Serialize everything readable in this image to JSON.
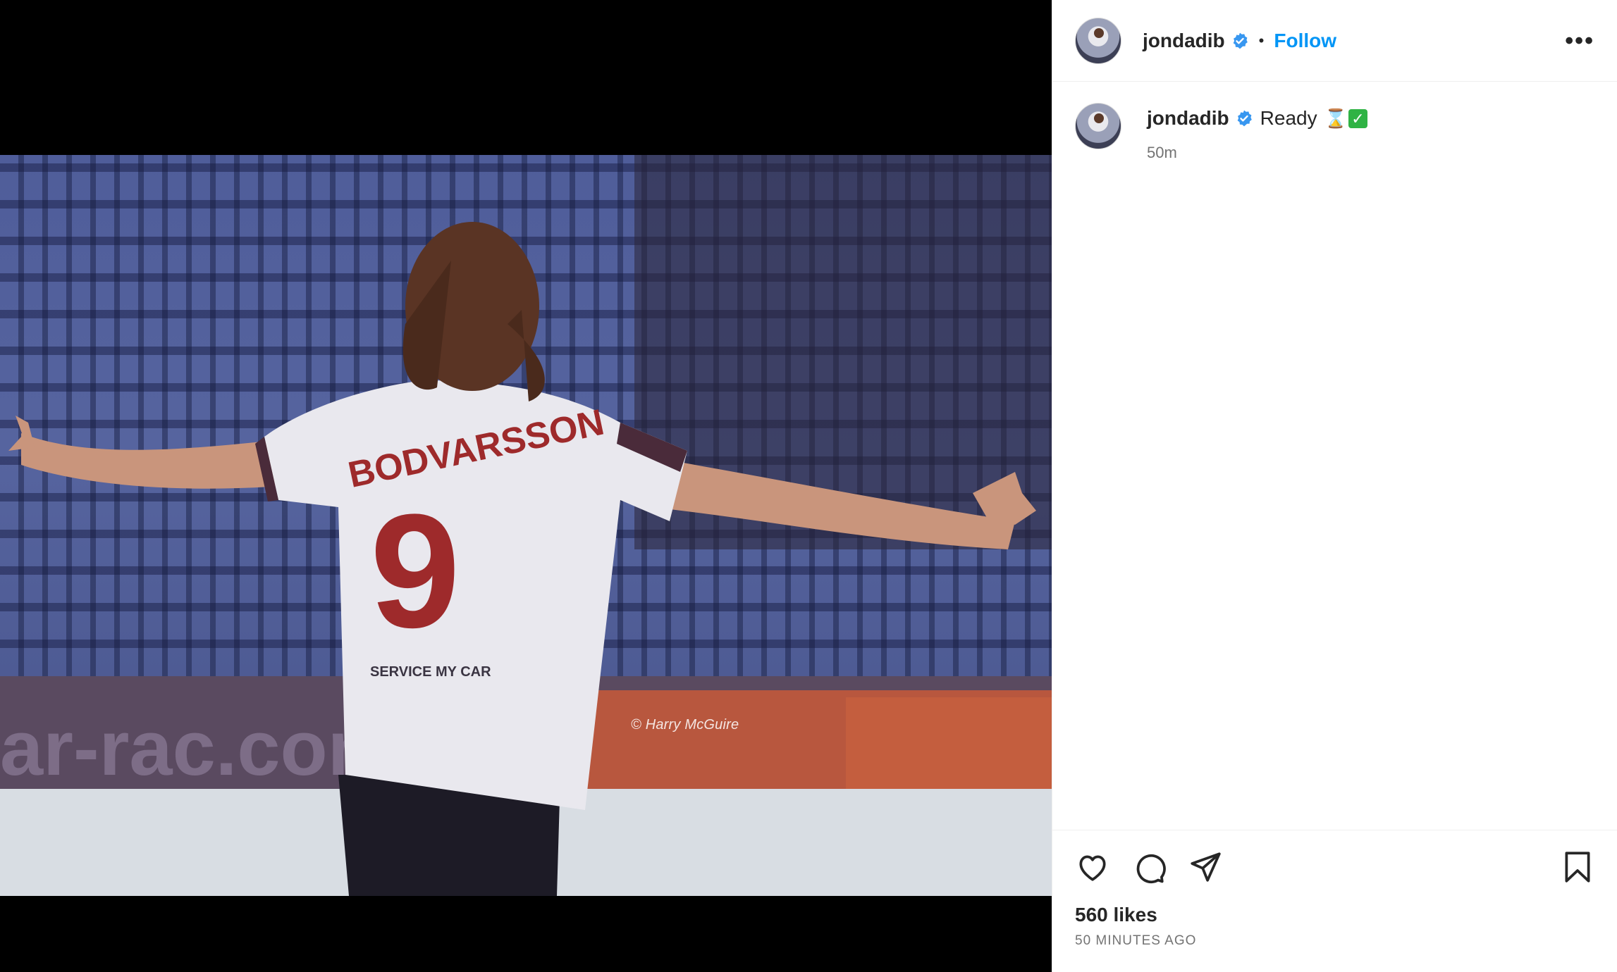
{
  "header": {
    "username": "jondadib",
    "separator": "•",
    "follow_label": "Follow",
    "more_label": "•••",
    "verified": true
  },
  "caption": {
    "username": "jondadib",
    "text": "Ready",
    "emoji_hourglass": "⌛",
    "emoji_check": "✓",
    "time_ago": "50m"
  },
  "media": {
    "watermark": "© Harry McGuire",
    "jersey_name": "BODVARSSON",
    "jersey_number": "9",
    "sponsor": "SERVICE MY CAR",
    "banner_text": "ar-rac.com"
  },
  "footer": {
    "likes": "560 likes",
    "date": "50 MINUTES AGO"
  },
  "colors": {
    "accent": "#0095f6",
    "verified": "#3897f0",
    "check_green": "#2fb344",
    "text": "#262626",
    "muted": "#737373"
  },
  "icons": {
    "like": "heart-icon",
    "comment": "comment-icon",
    "share": "share-icon",
    "save": "bookmark-icon",
    "more": "more-icon"
  }
}
